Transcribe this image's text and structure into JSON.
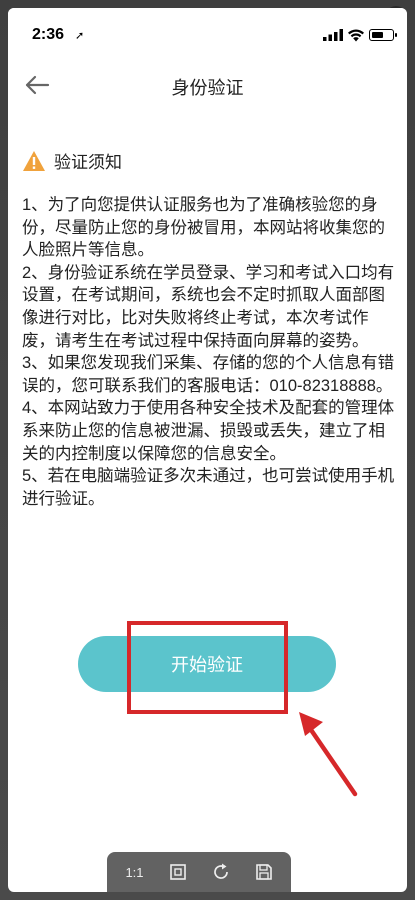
{
  "status_bar": {
    "time": "2:36",
    "location_glyph": "➚"
  },
  "header": {
    "title": "身份验证"
  },
  "notice": {
    "title": "验证须知",
    "paragraphs": [
      "1、为了向您提供认证服务也为了准确核验您的身份，尽量防止您的身份被冒用，本网站将收集您的人脸照片等信息。",
      "2、身份验证系统在学员登录、学习和考试入口均有设置，在考试期间，系统也会不定时抓取人面部图像进行对比，比对失败将终止考试，本次考试作废，请考生在考试过程中保持面向屏幕的姿势。",
      "3、如果您发现我们采集、存储的您的个人信息有错误的，您可联系我们的客服电话：010-82318888。",
      "4、本网站致力于使用各种安全技术及配套的管理体系来防止您的信息被泄漏、损毁或丢失，建立了相关的内控制度以保障您的信息安全。",
      "5、若在电脑端验证多次未通过，也可尝试使用手机进行验证。"
    ]
  },
  "actions": {
    "start_label": "开始验证"
  },
  "toolbar": {
    "actual_size_label": "1:1"
  },
  "colors": {
    "accent": "#5bc4cc",
    "annotation": "#d6282a",
    "warning": "#f0a23c"
  },
  "icons": [
    "back-arrow-icon",
    "warning-icon",
    "fit-screen-icon",
    "rotate-icon",
    "save-icon",
    "close-icon"
  ]
}
